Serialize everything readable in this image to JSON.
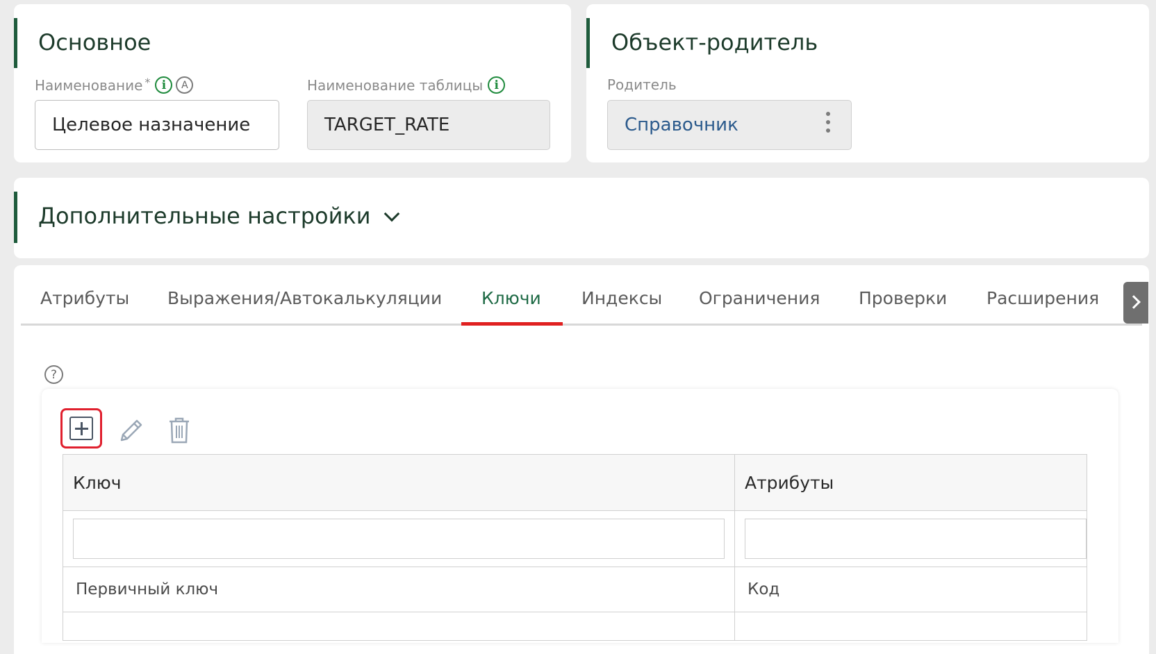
{
  "main_section": {
    "title": "Основное",
    "name_label": "Наименование",
    "name_required": "*",
    "name_value": "Целевое назначение",
    "table_label": "Наименование таблицы",
    "table_value": "TARGET_RATE"
  },
  "parent_section": {
    "title": "Объект-родитель",
    "parent_label": "Родитель",
    "parent_value": "Справочник"
  },
  "extra_section": {
    "title": "Дополнительные настройки"
  },
  "tabs": [
    {
      "label": "Атрибуты",
      "active": false
    },
    {
      "label": "Выражения/Автокалькуляции",
      "active": false
    },
    {
      "label": "Ключи",
      "active": true
    },
    {
      "label": "Индексы",
      "active": false
    },
    {
      "label": "Ограничения",
      "active": false
    },
    {
      "label": "Проверки",
      "active": false
    },
    {
      "label": "Расширения",
      "active": false
    }
  ],
  "icons": {
    "info": "info-icon",
    "autocomplete": "a-icon",
    "help": "help-icon",
    "add": "add-icon",
    "edit": "pencil-icon",
    "delete": "trash-icon"
  },
  "glyphs": {
    "info": "i",
    "autocomplete": "A",
    "help": "?"
  },
  "colors": {
    "accent": "#1e5b3c",
    "active_tab": "#e02020",
    "link": "#2b5a8c"
  },
  "keys_table": {
    "columns": [
      "Ключ",
      "Атрибуты"
    ],
    "rows": [
      {
        "key": "Первичный ключ",
        "attributes": "Код"
      }
    ]
  }
}
